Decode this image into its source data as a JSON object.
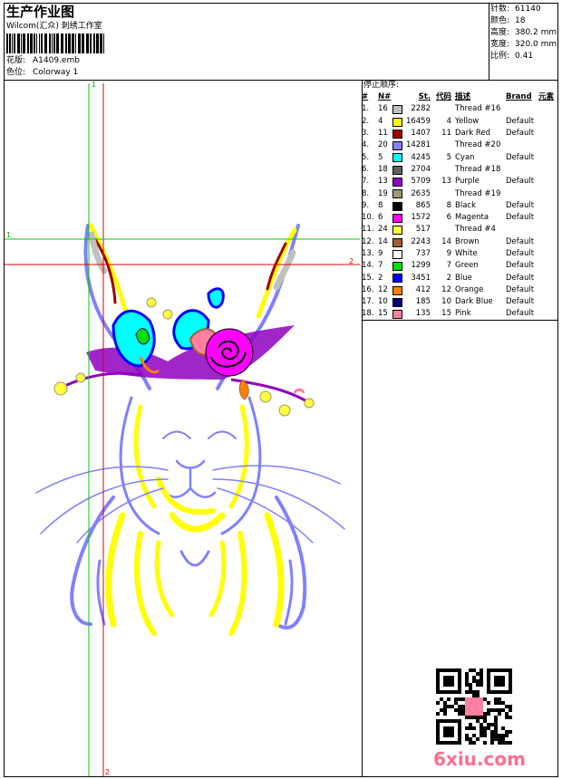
{
  "header": {
    "title": "生产作业图",
    "company": "Wilcom(汇众) 刺绣工作室",
    "design_label": "花版:",
    "design_value": "A1409.emb",
    "colorway_label": "色位:",
    "colorway_value": "Colorway 1"
  },
  "stats": [
    {
      "label": "针数:",
      "value": "61140"
    },
    {
      "label": "颜色:",
      "value": "18"
    },
    {
      "label": "高度:",
      "value": "380.2 mm"
    },
    {
      "label": "宽度:",
      "value": "320.0 mm"
    },
    {
      "label": "比例:",
      "value": "0.41"
    }
  ],
  "sequence": {
    "heading": "停止顺序:",
    "columns": [
      "#",
      "N#",
      "St.",
      "代码",
      "描述",
      "Brand",
      "元素"
    ],
    "rows": [
      {
        "idx": "1.",
        "n": "16",
        "color": "#c0c0c0",
        "st": "2282",
        "code": "",
        "desc": "Thread #16",
        "brand": ""
      },
      {
        "idx": "2.",
        "n": "4",
        "color": "#ffff00",
        "st": "16459",
        "code": "4",
        "desc": "Yellow",
        "brand": "Default"
      },
      {
        "idx": "3.",
        "n": "11",
        "color": "#a00000",
        "st": "1407",
        "code": "11",
        "desc": "Dark Red",
        "brand": "Default"
      },
      {
        "idx": "4.",
        "n": "20",
        "color": "#8080ff",
        "st": "14281",
        "code": "",
        "desc": "Thread #20",
        "brand": ""
      },
      {
        "idx": "5.",
        "n": "5",
        "color": "#00ffff",
        "st": "4245",
        "code": "5",
        "desc": "Cyan",
        "brand": "Default"
      },
      {
        "idx": "6.",
        "n": "18",
        "color": "#606060",
        "st": "2704",
        "code": "",
        "desc": "Thread #18",
        "brand": ""
      },
      {
        "idx": "7.",
        "n": "13",
        "color": "#9000c0",
        "st": "5709",
        "code": "13",
        "desc": "Purple",
        "brand": "Default"
      },
      {
        "idx": "8.",
        "n": "19",
        "color": "#a09870",
        "st": "2635",
        "code": "",
        "desc": "Thread #19",
        "brand": ""
      },
      {
        "idx": "9.",
        "n": "8",
        "color": "#000000",
        "st": "865",
        "code": "8",
        "desc": "Black",
        "brand": "Default"
      },
      {
        "idx": "10.",
        "n": "6",
        "color": "#ff00ff",
        "st": "1572",
        "code": "6",
        "desc": "Magenta",
        "brand": "Default"
      },
      {
        "idx": "11.",
        "n": "24",
        "color": "#ffff40",
        "st": "517",
        "code": "",
        "desc": "Thread #4",
        "brand": ""
      },
      {
        "idx": "12.",
        "n": "14",
        "color": "#a06030",
        "st": "2243",
        "code": "14",
        "desc": "Brown",
        "brand": "Default"
      },
      {
        "idx": "13.",
        "n": "9",
        "color": "#ffffff",
        "st": "737",
        "code": "9",
        "desc": "White",
        "brand": "Default"
      },
      {
        "idx": "14.",
        "n": "7",
        "color": "#00e000",
        "st": "1299",
        "code": "7",
        "desc": "Green",
        "brand": "Default"
      },
      {
        "idx": "15.",
        "n": "2",
        "color": "#0000ff",
        "st": "3451",
        "code": "2",
        "desc": "Blue",
        "brand": "Default"
      },
      {
        "idx": "16.",
        "n": "12",
        "color": "#ff8000",
        "st": "412",
        "code": "12",
        "desc": "Orange",
        "brand": "Default"
      },
      {
        "idx": "17.",
        "n": "10",
        "color": "#000080",
        "st": "185",
        "code": "10",
        "desc": "Dark Blue",
        "brand": "Default"
      },
      {
        "idx": "18.",
        "n": "15",
        "color": "#ff80a0",
        "st": "135",
        "code": "15",
        "desc": "Pink",
        "brand": "Default"
      }
    ]
  },
  "guides": {
    "v1": "1",
    "v2": "2",
    "h1": "1",
    "h2": "2"
  },
  "watermark": "6xiu.com"
}
